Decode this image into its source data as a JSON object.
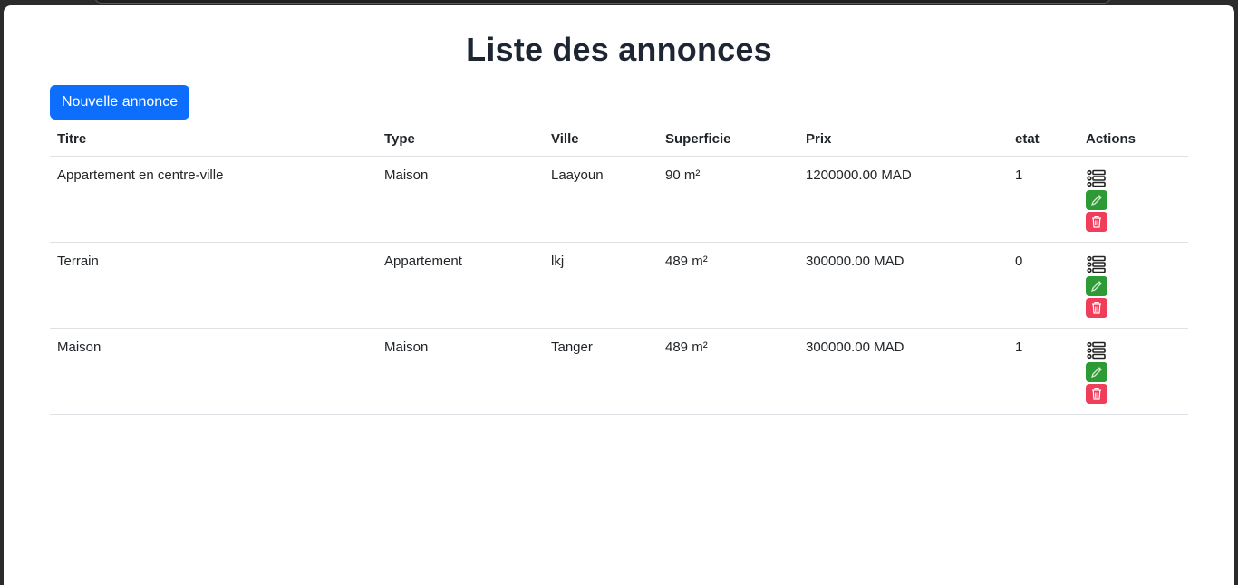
{
  "page": {
    "title": "Liste des annonces",
    "new_button": "Nouvelle annonce"
  },
  "table": {
    "headers": {
      "titre": "Titre",
      "type": "Type",
      "ville": "Ville",
      "superficie": "Superficie",
      "prix": "Prix",
      "etat": "etat",
      "actions": "Actions"
    },
    "rows": [
      {
        "titre": "Appartement en centre-ville",
        "type": "Maison",
        "ville": "Laayoun",
        "superficie": "90 m²",
        "prix": "1200000.00 MAD",
        "etat": "1"
      },
      {
        "titre": "Terrain",
        "type": "Appartement",
        "ville": "lkj",
        "superficie": "489 m²",
        "prix": "300000.00 MAD",
        "etat": "0"
      },
      {
        "titre": "Maison",
        "type": "Maison",
        "ville": "Tanger",
        "superficie": "489 m²",
        "prix": "300000.00 MAD",
        "etat": "1"
      }
    ]
  },
  "icons": {
    "details": "list-icon",
    "edit": "pencil-icon",
    "delete": "trash-icon"
  },
  "colors": {
    "primary": "#0d6efd",
    "edit": "#2e9a36",
    "delete": "#f03e5a"
  }
}
